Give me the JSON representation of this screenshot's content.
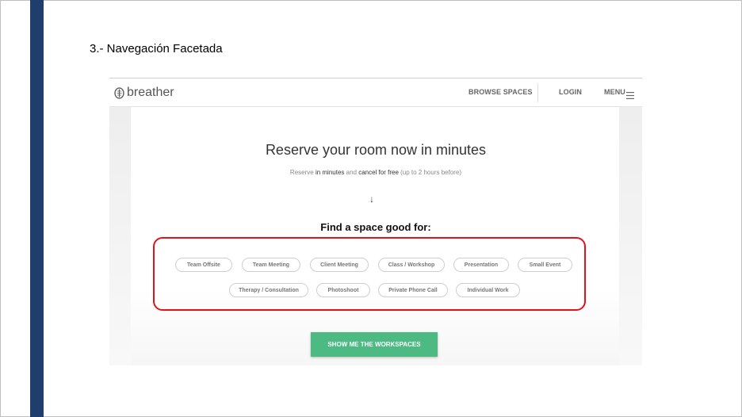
{
  "slide": {
    "title": "3.- Navegación Facetada"
  },
  "header": {
    "logo_text": "breather",
    "nav": {
      "browse": "BROWSE SPACES",
      "login": "LOGIN",
      "menu": "MENU"
    }
  },
  "hero": {
    "title": "Reserve your room now in minutes",
    "sub_part1": "Reserve ",
    "sub_part2": "in minutes",
    "sub_part3": " and ",
    "sub_part4": "cancel for free",
    "sub_part5": " (up to 2 hours before)",
    "arrow": "↓"
  },
  "find": {
    "title": "Find a space good for:",
    "chips_row1": [
      "Team Offsite",
      "Team Meeting",
      "Client Meeting",
      "Class / Workshop",
      "Presentation",
      "Small Event"
    ],
    "chips_row2": [
      "Therapy / Consultation",
      "Photoshoot",
      "Private Phone Call",
      "Individual Work"
    ]
  },
  "cta": {
    "label": "SHOW ME THE WORKSPACES"
  },
  "colors": {
    "sidebar": "#1f3e6e",
    "highlight": "#e3121b",
    "cta": "#4dba84"
  },
  "icons": {
    "logo": "breather-logo-icon",
    "menu": "hamburger-menu-icon",
    "arrow": "arrow-down-icon"
  }
}
